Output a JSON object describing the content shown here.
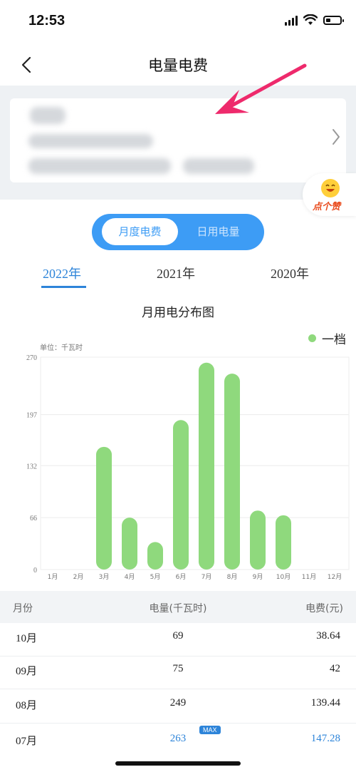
{
  "status": {
    "time": "12:53"
  },
  "header": {
    "title": "电量电费"
  },
  "badge": {
    "like_text": "点个赞"
  },
  "toggle": {
    "monthly": "月度电费",
    "daily": "日用电量"
  },
  "years": [
    "2022年",
    "2021年",
    "2020年"
  ],
  "colors": {
    "accent": "#3d9cf5",
    "bar": "#8fd97d",
    "link": "#2d84d9",
    "annotation_arrow": "#ee2a6c"
  },
  "chart_data": {
    "type": "bar",
    "title": "月用电分布图",
    "unit_label": "单位：千瓦时",
    "categories": [
      "1月",
      "2月",
      "3月",
      "4月",
      "5月",
      "6月",
      "7月",
      "8月",
      "9月",
      "10月",
      "11月",
      "12月"
    ],
    "series": [
      {
        "name": "一档",
        "values": [
          0,
          0,
          156,
          66,
          35,
          190,
          263,
          249,
          75,
          69,
          0,
          0
        ]
      }
    ],
    "y_ticks": [
      "0",
      "66",
      "132",
      "197",
      "270"
    ],
    "ylim": [
      0,
      270
    ],
    "legend_position": "top-right"
  },
  "table": {
    "headers": {
      "month": "月份",
      "kwh": "电量(千瓦时)",
      "fee": "电费(元)"
    },
    "rows": [
      {
        "month": "10月",
        "kwh": "69",
        "fee": "38.64"
      },
      {
        "month": "09月",
        "kwh": "75",
        "fee": "42"
      },
      {
        "month": "08月",
        "kwh": "249",
        "fee": "139.44"
      },
      {
        "month": "07月",
        "kwh": "263",
        "fee": "147.28",
        "badge": "MAX"
      }
    ]
  }
}
